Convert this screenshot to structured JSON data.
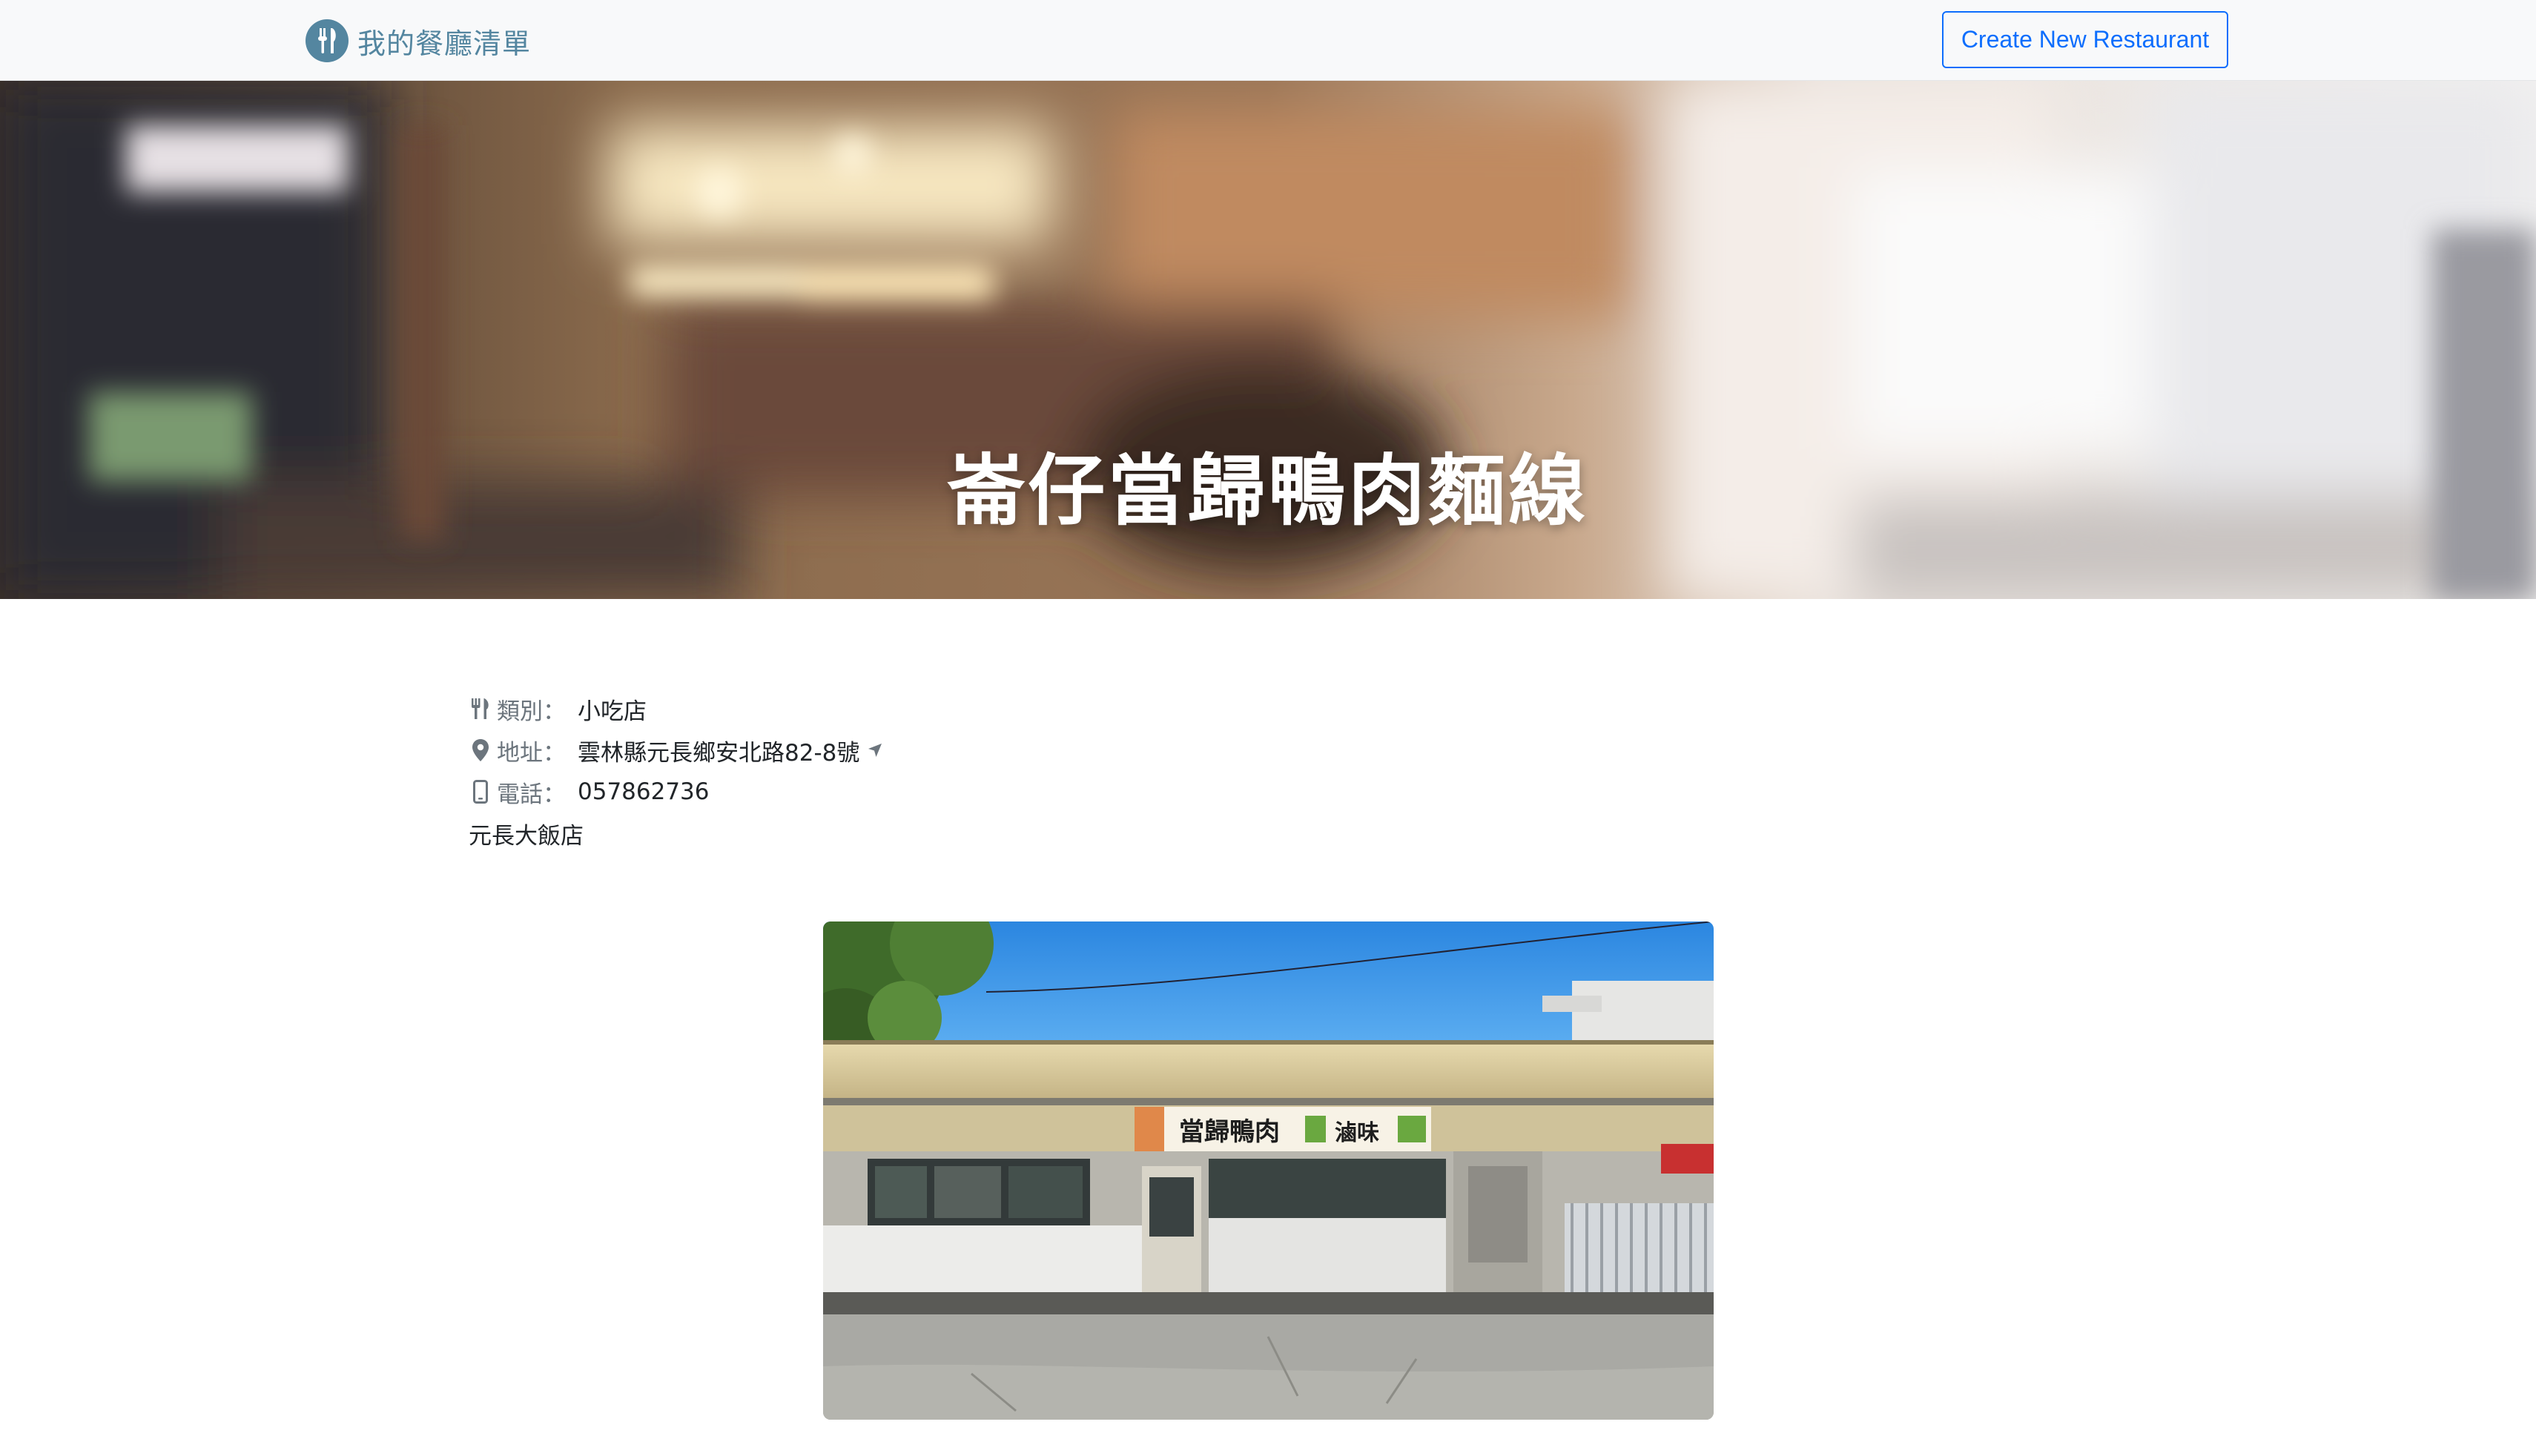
{
  "navbar": {
    "brand_title": "我的餐廳清單",
    "brand_icon": "utensils-icon",
    "create_button_label": "Create New Restaurant"
  },
  "banner": {
    "restaurant_name": "崙仔當歸鴨肉麵線"
  },
  "details": {
    "category_label": "類別：",
    "category_value": "小吃店",
    "address_label": "地址：",
    "address_value": "雲林縣元長鄉安北路82-8號",
    "phone_label": "電話：",
    "phone_value": "057862736",
    "description": "元長大飯店"
  },
  "photo": {
    "sign_text": "當歸鴨肉",
    "sign_side_text": "滷味",
    "alt": "restaurant storefront photo"
  },
  "colors": {
    "brand": "#5486a0",
    "primary": "#0d6efd",
    "navbar_bg": "#f8f9fa"
  }
}
